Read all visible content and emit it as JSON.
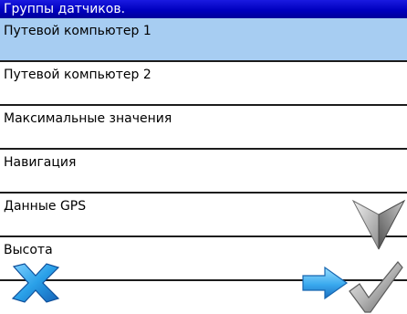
{
  "header": {
    "title": "Группы датчиков."
  },
  "sensor_groups": [
    {
      "label": "Путевой компьютер 1",
      "selected": true
    },
    {
      "label": "Путевой компьютер 2",
      "selected": false
    },
    {
      "label": "Максимальные значения",
      "selected": false
    },
    {
      "label": "Навигация",
      "selected": false
    },
    {
      "label": "Данные GPS",
      "selected": false
    },
    {
      "label": "Высота",
      "selected": false
    }
  ],
  "controls": {
    "scroll_down_icon": "chevron-down-icon",
    "cancel_icon": "close-icon",
    "next_icon": "arrow-right-icon",
    "confirm_icon": "checkmark-icon"
  },
  "colors": {
    "title_bar": "#0000bf",
    "selected_row": "#a7cdf2",
    "divider": "#1c1c1c",
    "accent_blue": "#2aa0e8"
  }
}
